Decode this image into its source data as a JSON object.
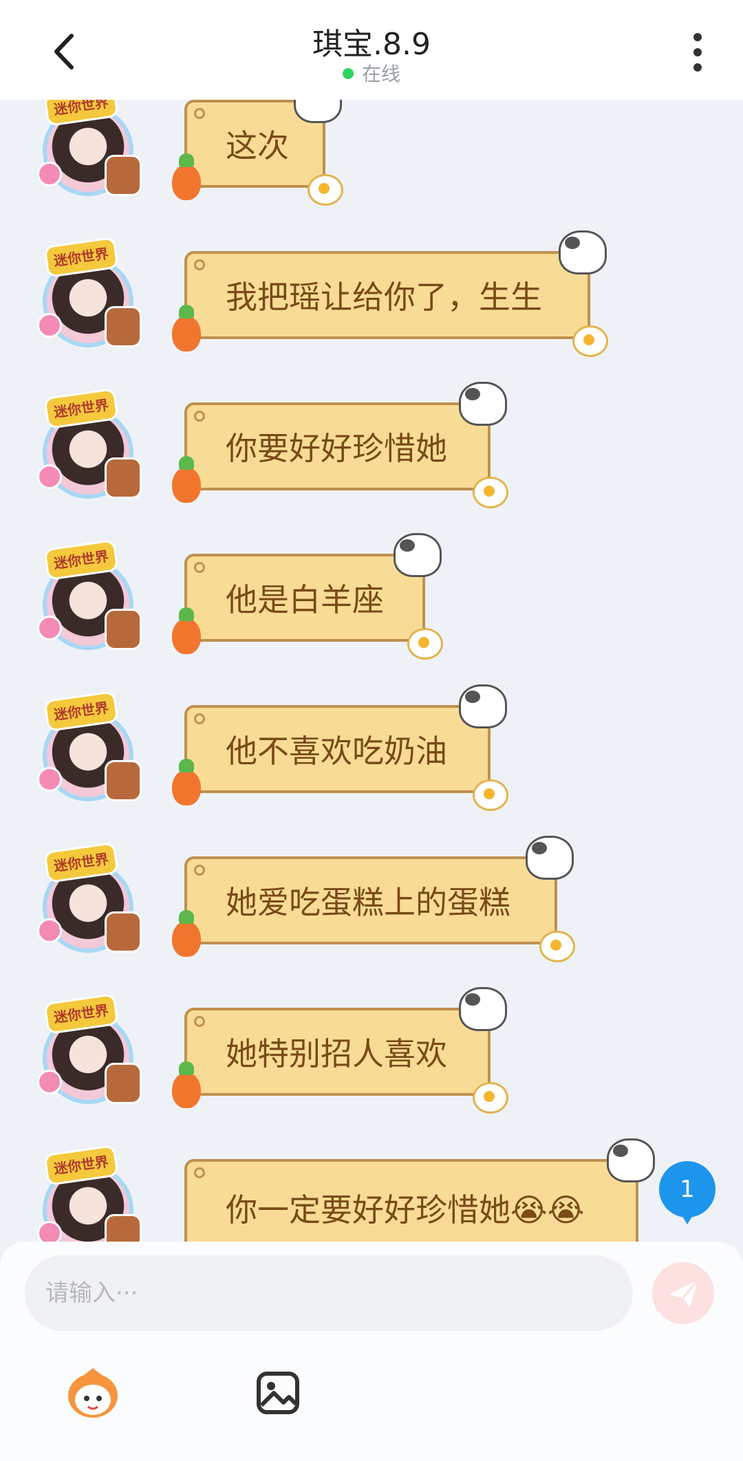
{
  "header": {
    "title": "琪宝.8.9",
    "status": "在线"
  },
  "messages": [
    {
      "text": "这次"
    },
    {
      "text": "我把瑶让给你了，生生"
    },
    {
      "text": "你要好好珍惜她"
    },
    {
      "text": "他是白羊座"
    },
    {
      "text": "他不喜欢吃奶油"
    },
    {
      "text": "她爱吃蛋糕上的蛋糕"
    },
    {
      "text": "她特别招人喜欢"
    },
    {
      "text": "你一定要好好珍惜她😭😭"
    }
  ],
  "unread_count": "1",
  "composer": {
    "placeholder": "请输入···"
  },
  "colors": {
    "bubble_fill": "#f8dc96",
    "bubble_border": "#c0904e",
    "bubble_text": "#7a4a18",
    "online": "#2fd35c",
    "unread_badge": "#1e95ec"
  },
  "icons": [
    "back-arrow-icon",
    "more-vertical-icon",
    "send-icon",
    "emoji-sticker-icon",
    "image-icon"
  ]
}
